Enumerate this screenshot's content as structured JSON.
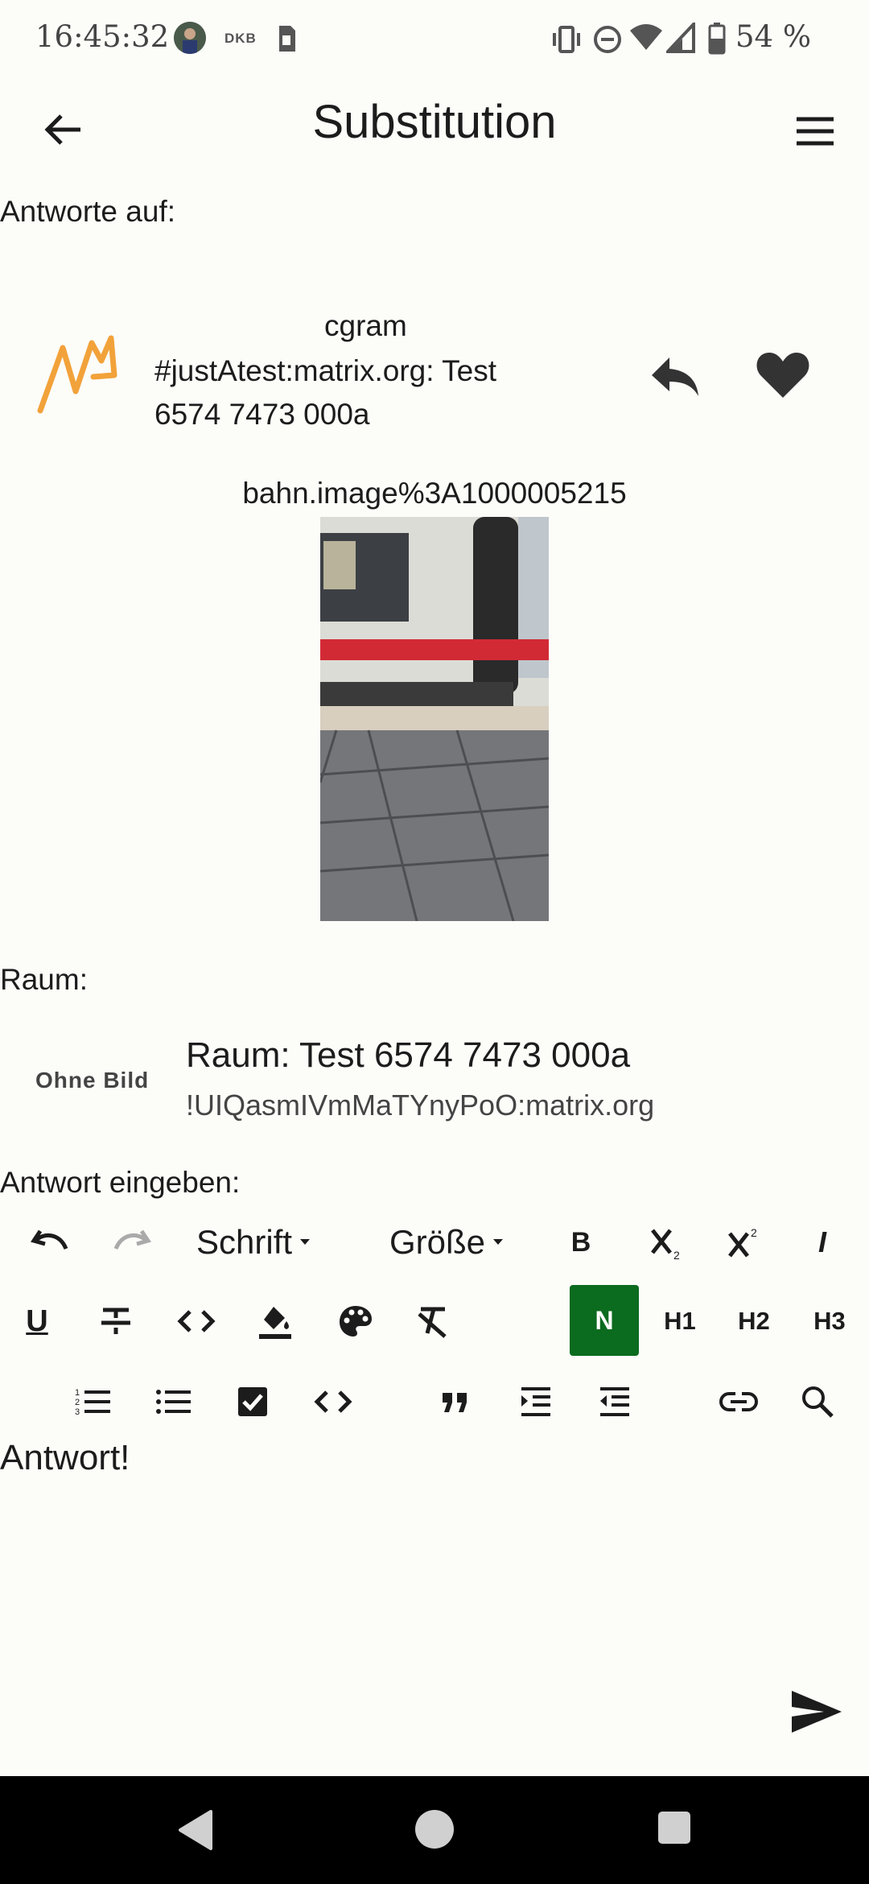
{
  "status_bar": {
    "time": "16:45:32",
    "carrier_badge": "DKB",
    "battery": "54 %"
  },
  "app_bar": {
    "title": "Substitution"
  },
  "reply_to": {
    "label": "Antworte auf:",
    "sender": "cgram",
    "body": "#justAtest:matrix.org: Test 6574 7473 000a",
    "attachment_name": "bahn.image%3A1000005215",
    "avatar_icon": "matrix-m-logo-icon",
    "avatar_color": "#f2a23a"
  },
  "room": {
    "label": "Raum:",
    "no_image": "Ohne Bild",
    "name": "Raum: Test 6574 7473 000a",
    "id": "!UIQasmIVmMaTYnyPoO:matrix.org"
  },
  "editor": {
    "label": "Antwort eingeben:",
    "font_dropdown": "Schrift",
    "size_dropdown": "Größe",
    "bold": "B",
    "italic": "I",
    "underline": "U",
    "style_normal": "N",
    "h1": "H1",
    "h2": "H2",
    "h3": "H3",
    "text": "Antwort!",
    "active_style_color": "#0b6b1f"
  }
}
